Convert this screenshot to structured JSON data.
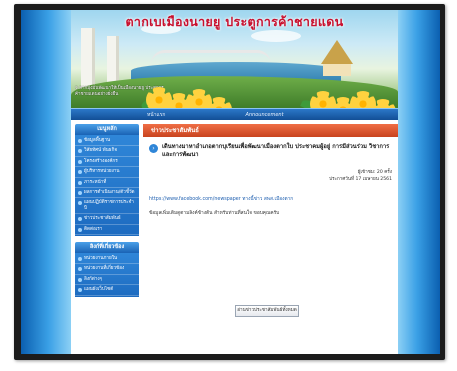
{
  "banner": {
    "title": "ตากเบเมืองนายยู ประตูการค้าชายแดน",
    "caption": "จ.ตากมุ่งมั่นพัฒนาให้เป็นเมืองนายยู ประตูการค้าชายแดนอย่างยั่งยืน"
  },
  "navbar": {
    "items": [
      "หน้าแรก",
      "Announcement"
    ]
  },
  "sidebar": {
    "menu1_title": "เมนูหลัก",
    "menu1_items": [
      "ข้อมูลพื้นฐาน",
      "วิสัยทัศน์ พันธกิจ",
      "โครงสร้างองค์กร",
      "ผู้บริหารหน่วยงาน",
      "ภาระหน้าที่",
      "ผลการดำเนินงาน/ตัวชี้วัด",
      "แผนปฏิบัติราชการประจำปี",
      "ข่าวประชาสัมพันธ์",
      "ติดต่อเรา"
    ],
    "menu2_title": "ลิงก์ที่เกี่ยวข้อง",
    "menu2_items": [
      "หน่วยงานภายใน",
      "หน่วยงานที่เกี่ยวข้อง",
      "ลิงก์ต่างๆ",
      "แผนผังเว็บไซต์"
    ]
  },
  "content": {
    "header": "ข่าวประชาสัมพันธ์",
    "article": {
      "title": "เดินทางมาหาอำเภอตากบุเรียนเพื่อพัฒนาเมืองตากใบ ประชาคมผู้อยู่ การมีส่วนร่วม วิชาการและการพัฒนา",
      "meta_views": "ผู้เข้าชม: 20 ครั้ง",
      "meta_date": "ประกาศวันที่ 17 เมษายน 2561",
      "link": "https://www.facebook.com/newspaper ทางนี้ข่าว สพส.เมืองตาก",
      "body": "ข้อมูลเพิ่มเติมดูตามลิงค์ข้างต้น สำหรับท่านที่สนใจ ขอบคุณครับ"
    },
    "more_button": "อ่านข่าวประชาสัมพันธ์ทั้งหมด"
  },
  "colors": {
    "accent_blue": "#1d6bc0",
    "header_orange": "#c8431e",
    "title_red": "#c8102e"
  }
}
